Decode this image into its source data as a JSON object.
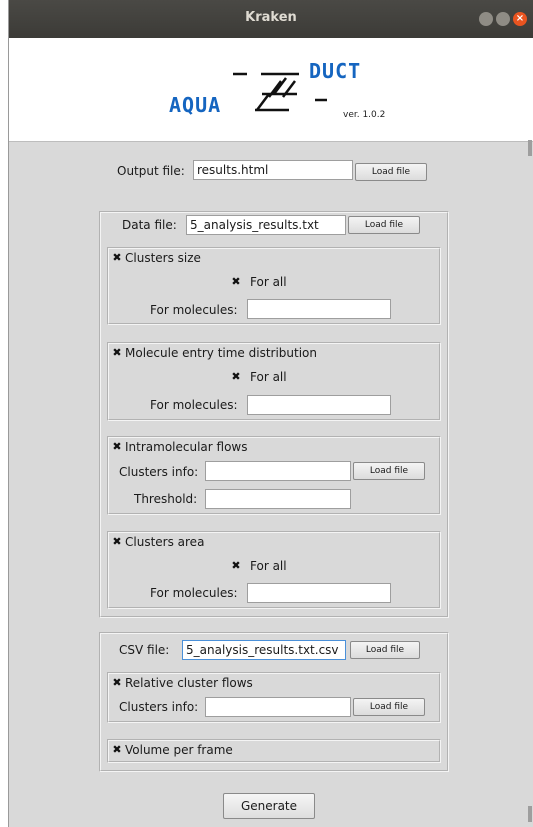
{
  "window": {
    "title": "Kraken"
  },
  "logo": {
    "text_top": "DUCT",
    "text_bottom": "AQUA",
    "version": "ver. 1.0.2",
    "color": "#1565c0"
  },
  "output": {
    "label": "Output file:",
    "value": "results.html",
    "button": "Load file"
  },
  "data_section": {
    "label": "Data file:",
    "value": "5_analysis_results.txt",
    "button": "Load file",
    "clusters_size": {
      "check": "✖",
      "title": "Clusters size",
      "for_all": "For all",
      "for_molecules": "For molecules:"
    },
    "entry_time": {
      "check": "✖",
      "title": "Molecule entry time distribution",
      "for_all": "For all",
      "for_molecules": "For molecules:"
    },
    "intramolecular": {
      "check": "✖",
      "title": "Intramolecular flows",
      "clusters_info": "Clusters info:",
      "button": "Load file",
      "threshold": "Threshold:"
    },
    "clusters_area": {
      "check": "✖",
      "title": "Clusters area",
      "for_all": "For all",
      "for_molecules": "For molecules:"
    }
  },
  "csv_section": {
    "label": "CSV file:",
    "value": "5_analysis_results.txt.csv",
    "button": "Load file",
    "relative_flows": {
      "check": "✖",
      "title": "Relative cluster flows",
      "clusters_info": "Clusters info:",
      "button": "Load file"
    },
    "volume": {
      "check": "✖",
      "title": "Volume per frame"
    }
  },
  "generate": "Generate"
}
